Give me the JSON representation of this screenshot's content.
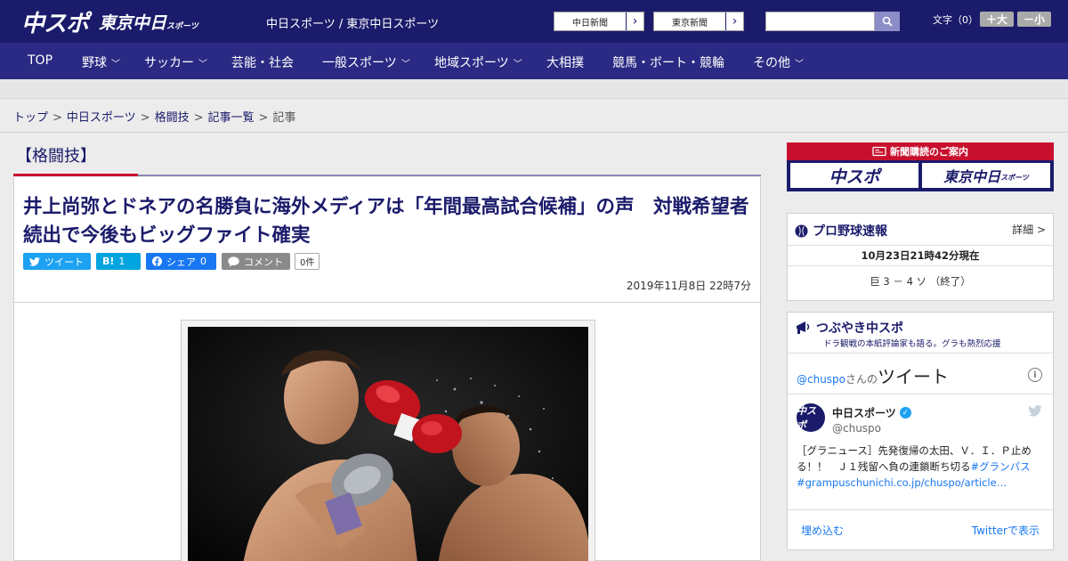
{
  "header": {
    "logo_main": "中スポ",
    "logo_sub": "東京中日",
    "logo_sub_small": "スポーツ",
    "site_links": "中日スポーツ / 東京中日スポーツ",
    "site_buttons": [
      {
        "label": "中日新聞"
      },
      {
        "label": "東京新聞"
      }
    ],
    "search_placeholder": "",
    "font_size_label": "文字（0）",
    "font_plus": "＋大",
    "font_minus": "－小"
  },
  "nav": {
    "items": [
      {
        "label": "TOP",
        "dropdown": false
      },
      {
        "label": "野球",
        "dropdown": true
      },
      {
        "label": "サッカー",
        "dropdown": true
      },
      {
        "label": "芸能・社会",
        "dropdown": false
      },
      {
        "label": "一般スポーツ",
        "dropdown": true
      },
      {
        "label": "地域スポーツ",
        "dropdown": true
      },
      {
        "label": "大相撲",
        "dropdown": false
      },
      {
        "label": "競馬・ボート・競輪",
        "dropdown": false
      },
      {
        "label": "その他",
        "dropdown": true
      }
    ],
    "chevron": "﹀"
  },
  "breadcrumb": {
    "items": [
      "トップ",
      "中日スポーツ",
      "格闘技",
      "記事一覧"
    ],
    "current": "記事",
    "separator": ">"
  },
  "article": {
    "category": "【格闘技】",
    "headline": "井上尚弥とドネアの名勝負に海外メディアは「年間最高試合候補」の声　対戦希望者続出で今後もビッグファイト確実",
    "share": {
      "tweet": "ツイート",
      "hatena": "B!",
      "hatena_count": "1",
      "facebook": "シェア",
      "facebook_count": "0",
      "comment": "コメント",
      "comment_count": "0件"
    },
    "date": "2019年11月8日 22時7分"
  },
  "sidebar": {
    "subscription": {
      "header": "新聞購読のご案内",
      "buttons": [
        "中スポ",
        "東京中日"
      ],
      "button_small": "スポーツ"
    },
    "baseball": {
      "title": "プロ野球速報",
      "more": "詳細 >",
      "time": "10月23日21時42分現在",
      "score": "巨 3 － 4 ソ （終了）"
    },
    "twitter": {
      "title": "つぶやき中スポ",
      "subtitle": "ドラ観戦の本紙評論家も語る。グラも熱烈応援",
      "handle_prefix": "@chuspo",
      "handle_suffix": "さんの",
      "handle_big": "ツイート",
      "account_name": "中日スポーツ",
      "screen_name": "@chuspo",
      "avatar_text": "中スポ",
      "tweet_text": "［グラニュース］先発復帰の太田、Ｖ．Ｉ．Ｐ止める！！　Ｊ１残留へ負の連鎖断ち切る",
      "tweet_hashtag": "#グランパス",
      "tweet_link": "#grampuschunichi.co.jp/chuspo/article…",
      "embed": "埋め込む",
      "view": "Twitterで表示"
    }
  },
  "colors": {
    "brand": "#1b1b6b",
    "nav": "#2a2a84",
    "accent_red": "#c8102e",
    "twitter": "#1da1f2"
  }
}
